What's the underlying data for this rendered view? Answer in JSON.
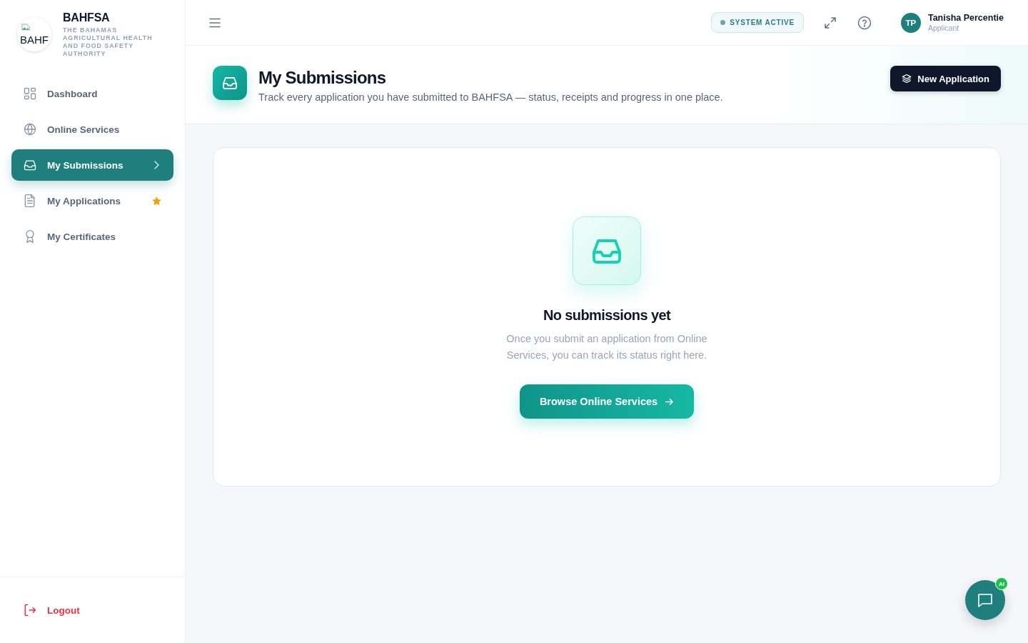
{
  "brand": {
    "logo_text": "BAHF",
    "name": "BAHFSA",
    "subtitle": "THE BAHAMAS AGRICULTURAL HEALTH AND FOOD SAFETY AUTHORITY"
  },
  "nav": [
    {
      "label": "Dashboard",
      "selected": false,
      "starred": false
    },
    {
      "label": "Online Services",
      "selected": false,
      "starred": false
    },
    {
      "label": "My Submissions",
      "selected": true,
      "starred": false
    },
    {
      "label": "My Applications",
      "selected": false,
      "starred": true
    },
    {
      "label": "My Certificates",
      "selected": false,
      "starred": false
    }
  ],
  "logout": {
    "label": "Logout"
  },
  "topbar": {
    "status": "SYSTEM ACTIVE",
    "user": {
      "initials": "TP",
      "name": "Tanisha Percentie",
      "role": "Applicant"
    }
  },
  "page_header": {
    "title": "My Submissions",
    "description": "Track every application you have submitted to BAHFSA — status, receipts and progress in one place.",
    "button": "New Application"
  },
  "empty_state": {
    "title": "No submissions yet",
    "message": "Once you submit an application from Online Services, you can track its status right here.",
    "button": "Browse Online Services"
  },
  "chat": {
    "badge": "AI"
  }
}
